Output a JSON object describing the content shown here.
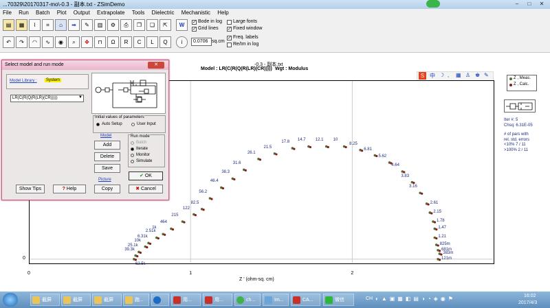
{
  "window": {
    "title": "...70329\\20170317-mo\\-0.3 - 副本.txt - ZSimDemo",
    "min": "–",
    "max": "□",
    "close": "✕"
  },
  "menu": [
    "File",
    "Run",
    "Batch",
    "Plot",
    "Output",
    "Extrapolate",
    "Tools",
    "Dielectric",
    "Mechanistic",
    "Help"
  ],
  "options": {
    "bode_in_log": "Bode in log",
    "grid_lines": "Grid lines",
    "large_fonts": "Large fonts",
    "fixed_window": "Fixed window",
    "freq_labels": "Freq. labels",
    "re_im_in_log": "Re/Im in log",
    "area_value": "0.0706",
    "area_unit": "sq.cm"
  },
  "plot": {
    "file_title": "-0.3 - 副本.txt",
    "model_line": "Model : LR(C(R(Q(R(LR)(CR)))))",
    "weight_line": "Wgt : Modulus",
    "xlabel": "Z ' (ohm-sq. cm)",
    "x_ticks": [
      "0",
      "1",
      "2"
    ],
    "y_ticks": [
      "0"
    ]
  },
  "legend": {
    "meas": "Z , Meas.",
    "calc": "Z , Calc."
  },
  "info": {
    "iter": "Iter #:   5",
    "chsq": "Chsq:   6.31E-05",
    "pars_title": "# of pars with",
    "pars_sub": "  rel. std. errors",
    "lt10": "<10%    7 / 11",
    "gt100": ">100%    2 / 11"
  },
  "chart_data": {
    "type": "scatter",
    "title": "-0.3 - 副本.txt",
    "xlabel": "Z ' (ohm-sq. cm)",
    "ylabel": "",
    "xlim": [
      0,
      2.87
    ],
    "ylim": [
      -0.02,
      1.0
    ],
    "series": [
      {
        "name": "Z , Meas.",
        "color": "#556b2f"
      },
      {
        "name": "Z , Calc.",
        "color": "#8b1a1a"
      }
    ],
    "points": [
      {
        "x": 0.65,
        "y": 0.0,
        "label": "62.5k"
      },
      {
        "x": 0.66,
        "y": 0.02,
        "label": "39.3k"
      },
      {
        "x": 0.68,
        "y": 0.04,
        "label": "25.1k"
      },
      {
        "x": 0.72,
        "y": 0.07,
        "label": "10k"
      },
      {
        "x": 0.74,
        "y": 0.09,
        "label": "6.31k"
      },
      {
        "x": 0.79,
        "y": 0.12,
        "label": "2.51k"
      },
      {
        "x": 0.83,
        "y": 0.14,
        "label": "1k"
      },
      {
        "x": 0.88,
        "y": 0.17,
        "label": "464"
      },
      {
        "x": 0.95,
        "y": 0.21,
        "label": "215"
      },
      {
        "x": 1.02,
        "y": 0.25,
        "label": "122"
      },
      {
        "x": 1.07,
        "y": 0.28,
        "label": "82.5"
      },
      {
        "x": 1.12,
        "y": 0.34,
        "label": "56.2"
      },
      {
        "x": 1.19,
        "y": 0.4,
        "label": "46.4"
      },
      {
        "x": 1.26,
        "y": 0.45,
        "label": "38.3"
      },
      {
        "x": 1.33,
        "y": 0.5,
        "label": "31.6"
      },
      {
        "x": 1.42,
        "y": 0.56,
        "label": "26.1"
      },
      {
        "x": 1.52,
        "y": 0.59,
        "label": "21.5"
      },
      {
        "x": 1.63,
        "y": 0.62,
        "label": "17.8"
      },
      {
        "x": 1.73,
        "y": 0.63,
        "label": "14.7"
      },
      {
        "x": 1.84,
        "y": 0.63,
        "label": "12.1"
      },
      {
        "x": 1.95,
        "y": 0.63,
        "label": "10"
      },
      {
        "x": 2.05,
        "y": 0.61,
        "label": "8.25"
      },
      {
        "x": 2.14,
        "y": 0.58,
        "label": "6.81"
      },
      {
        "x": 2.23,
        "y": 0.54,
        "label": "5.62"
      },
      {
        "x": 2.31,
        "y": 0.49,
        "label": "4.64"
      },
      {
        "x": 2.37,
        "y": 0.43,
        "label": "3.83"
      },
      {
        "x": 2.42,
        "y": 0.37,
        "label": "3.16"
      },
      {
        "x": 2.46,
        "y": 0.31,
        "label": "2.61"
      },
      {
        "x": 2.48,
        "y": 0.26,
        "label": "2.15"
      },
      {
        "x": 2.5,
        "y": 0.21,
        "label": "1.78"
      },
      {
        "x": 2.51,
        "y": 0.17,
        "label": "1.47"
      },
      {
        "x": 2.51,
        "y": 0.12,
        "label": "1.21"
      },
      {
        "x": 2.52,
        "y": 0.08,
        "label": "825m"
      },
      {
        "x": 2.53,
        "y": 0.05,
        "label": "681m"
      },
      {
        "x": 2.54,
        "y": 0.03,
        "label": "383m"
      },
      {
        "x": 2.53,
        "y": 0.0,
        "label": "121m"
      }
    ]
  },
  "dialog": {
    "title": "Select model and run mode",
    "tab_library": "Model Library :",
    "tab_system": "System",
    "model_select": "LR(C(R(Q(R(LR)(CR)))))",
    "init_title": "Initial values of parameters",
    "auto_setup": "Auto Setup",
    "user_input": "User Input",
    "model_link": "Model",
    "add": "Add",
    "delete": "Delete",
    "save": "Save",
    "picture_link": "Picture",
    "copy": "Copy",
    "run_title": "Run mode",
    "batch": "Batch",
    "iterate": "Iterate",
    "monitor": "Monitor",
    "simulate": "Simulate",
    "ok": "OK",
    "cancel": "Cancel",
    "show_tips": "Show Tips",
    "help": "Help"
  },
  "taskbar": {
    "items": [
      "截屏",
      "截屏",
      "截屏",
      "跑...",
      "",
      "用...",
      "用...",
      "ch...",
      "Im...",
      "CA...",
      "微信"
    ],
    "lang": "CH",
    "time": "16:02",
    "date": "2017/4/3"
  }
}
